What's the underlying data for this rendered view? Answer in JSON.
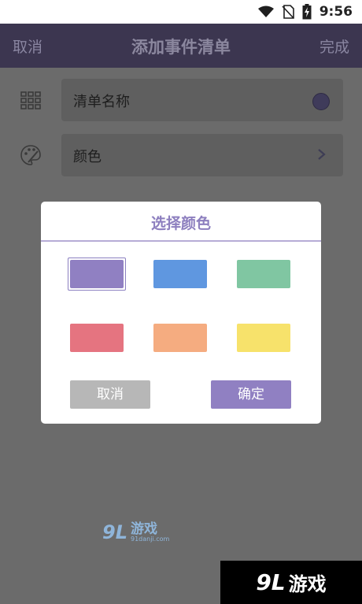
{
  "status": {
    "time": "9:56"
  },
  "appbar": {
    "left": "取消",
    "title": "添加事件清单",
    "right": "完成"
  },
  "form": {
    "name_label": "清单名称",
    "color_label": "颜色",
    "selected_color": "#3f3b5a"
  },
  "dialog": {
    "title": "选择颜色",
    "cancel": "取消",
    "ok": "确定",
    "swatches": [
      "#9080c2",
      "#5f97e0",
      "#80c6a2",
      "#e57480",
      "#f5ac80",
      "#f7e26b"
    ],
    "selected_index": 0
  },
  "watermark": {
    "center_logo": "9L",
    "center_cn": "游戏",
    "center_en": "91danji.com",
    "corner_logo": "9L",
    "corner_cn": "游戏"
  }
}
